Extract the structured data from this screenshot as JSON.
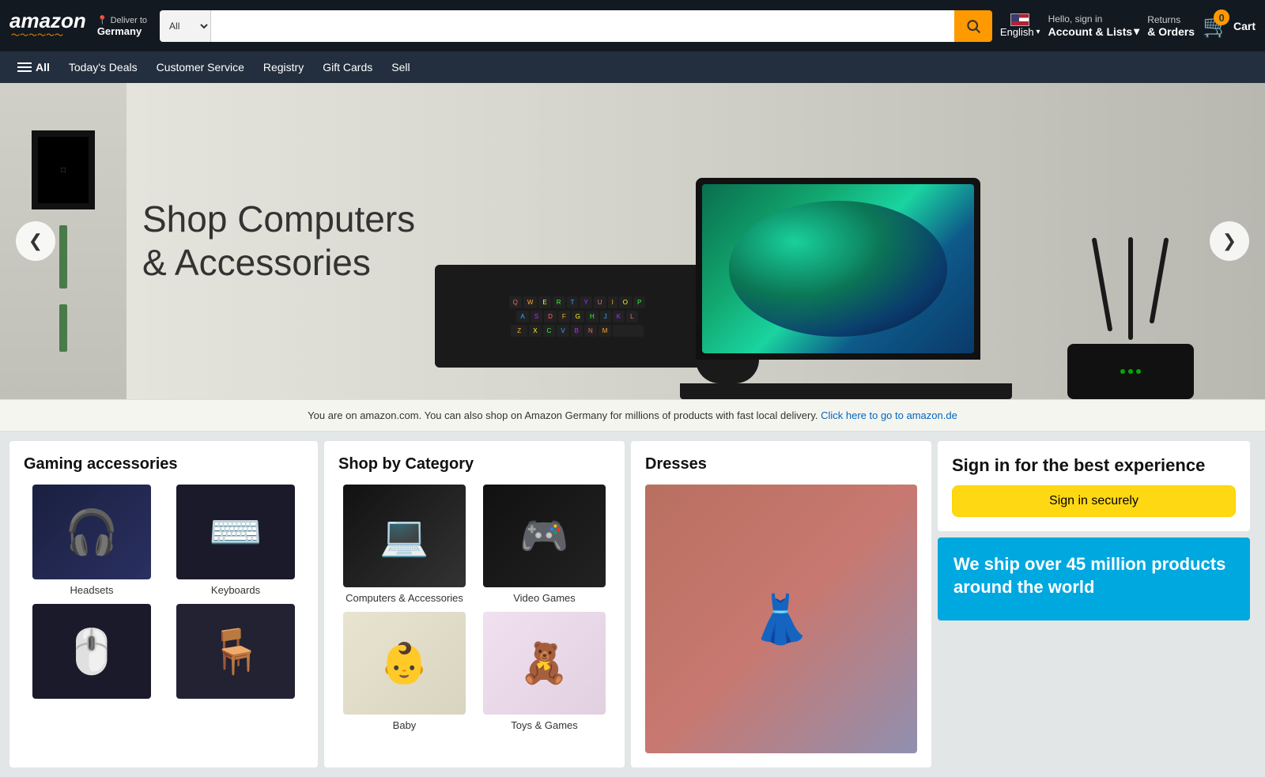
{
  "header": {
    "logo": "amazon",
    "logo_smile": "〜",
    "deliver_to": "Deliver to",
    "country": "Germany",
    "search_placeholder": "",
    "search_category": "All",
    "language": "English",
    "hello": "Hello, sign in",
    "account_lists": "Account & Lists",
    "account_caret": "▾",
    "returns": "Returns",
    "orders": "& Orders",
    "cart_count": "0",
    "cart_label": "Cart"
  },
  "nav": {
    "all_label": "All",
    "items": [
      {
        "label": "Today's Deals"
      },
      {
        "label": "Customer Service"
      },
      {
        "label": "Registry"
      },
      {
        "label": "Gift Cards"
      },
      {
        "label": "Sell"
      }
    ]
  },
  "banner": {
    "title_line1": "Shop Computers",
    "title_line2": "& Accessories",
    "nav_left": "❮",
    "nav_right": "❯"
  },
  "germany_notice": {
    "text": "You are on amazon.com. You can also shop on Amazon Germany for millions of products with fast local delivery.",
    "link_text": "Click here to go to amazon.de"
  },
  "gaming_card": {
    "title": "Gaming accessories",
    "items": [
      {
        "label": "Headsets",
        "emoji": "🎧",
        "bg": "#1a2040"
      },
      {
        "label": "Keyboards",
        "emoji": "⌨️",
        "bg": "#1a1a2a"
      },
      {
        "label": "",
        "emoji": "🖱️",
        "bg": "#1a1a2a"
      },
      {
        "label": "",
        "emoji": "🪑",
        "bg": "#222233"
      }
    ]
  },
  "category_card": {
    "title": "Shop by Category",
    "items": [
      {
        "label": "Computers & Accessories",
        "emoji": "💻",
        "bg": "#111"
      },
      {
        "label": "Video Games",
        "emoji": "🎮",
        "bg": "#111"
      },
      {
        "label": "Baby",
        "emoji": "👶",
        "bg": "#e8e4d0"
      },
      {
        "label": "Toys & Games",
        "emoji": "🧸",
        "bg": "#f0e0f0"
      }
    ]
  },
  "dresses_card": {
    "title": "Dresses",
    "emoji": "👗"
  },
  "signin_card": {
    "title": "Sign in for the best experience",
    "button": "Sign in securely"
  },
  "ship_card": {
    "text": "We ship over 45 million products around the world"
  }
}
